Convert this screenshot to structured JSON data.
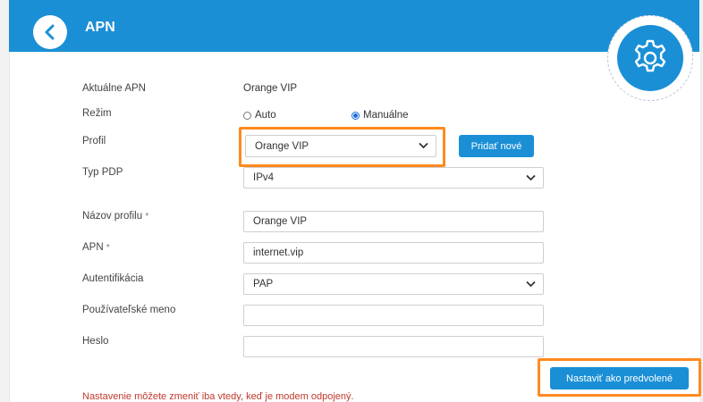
{
  "header": {
    "title": "APN"
  },
  "form": {
    "current_apn_label": "Aktuálne APN",
    "current_apn_value": "Orange VIP",
    "mode_label": "Režim",
    "mode_auto": "Auto",
    "mode_manual": "Manuálne",
    "mode_selected": "Manuálne",
    "profile_label": "Profil",
    "profile_value": "Orange VIP",
    "add_new_label": "Pridať nové",
    "pdp_label": "Typ PDP",
    "pdp_value": "IPv4",
    "profile_name_label": "Názov profilu",
    "profile_name_value": "Orange VIP",
    "apn_label": "APN",
    "apn_value": "internet.vip",
    "auth_label": "Autentifikácia",
    "auth_value": "PAP",
    "username_label": "Používateľské meno",
    "username_value": "",
    "password_label": "Heslo",
    "password_value": "",
    "required_mark": "*",
    "set_default_label": "Nastaviť ako predvolené",
    "note": "Nastavenie môžete zmeniť iba vtedy, keď je modem odpojený."
  },
  "colors": {
    "accent": "#1a8fd6",
    "highlight": "#ff8a1f",
    "note": "#c0392b"
  },
  "icons": {
    "back": "chevron-left-icon",
    "settings": "gear-icon",
    "dropdown": "chevron-down-icon"
  }
}
